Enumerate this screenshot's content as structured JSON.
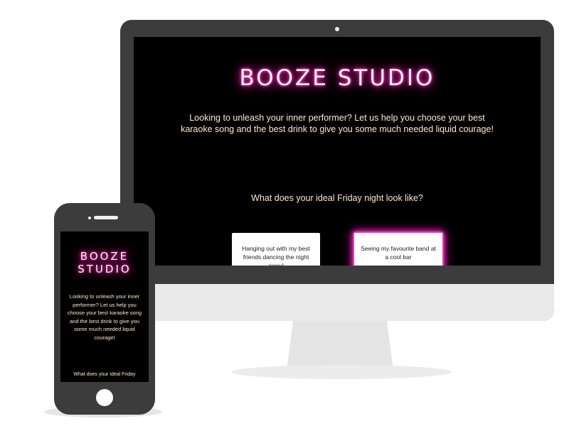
{
  "site": {
    "title": "BOOZE STUDIO",
    "title_mobile_line1": "BOOZE",
    "title_mobile_line2": "STUDIO",
    "intro": "Looking to unleash your inner performer? Let us help you choose your best karaoke song and the best drink to give you some much needed liquid courage!",
    "question": "What does your ideal Friday night look like?",
    "question_mobile_visible": "What does your ideal Friday",
    "answers": [
      {
        "label": "Hanging out with my best friends dancing the night away!"
      },
      {
        "label": "Seeing my favourite band at a cool bar"
      }
    ]
  },
  "colors": {
    "neon_pink": "#ff1aa8",
    "text_cream": "#ffe9c9",
    "screen_bg": "#000000",
    "device_frame": "#3c3c3c"
  },
  "icons": {
    "monitor_camera": "camera-dot-icon",
    "phone_speaker": "speaker-icon",
    "phone_home": "home-button-icon"
  }
}
